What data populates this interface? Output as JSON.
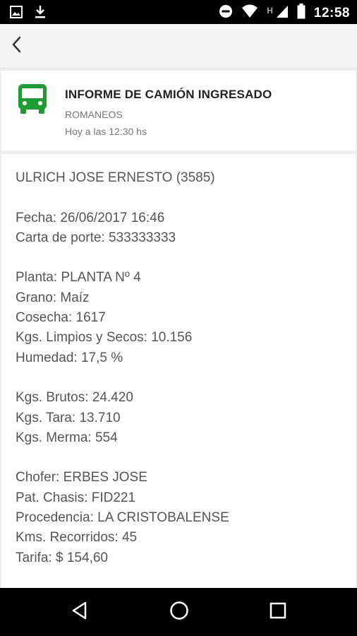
{
  "status_bar": {
    "time": "12:58",
    "network_badge": "H",
    "icons": [
      "image-icon",
      "download-icon",
      "do-not-disturb-icon",
      "wifi-icon",
      "signal-icon",
      "battery-icon"
    ]
  },
  "app_bar": {
    "back_icon": "back-arrow-icon"
  },
  "header": {
    "icon": "bus-icon",
    "icon_color": "#1e9b33",
    "title": "INFORME DE CAMIÓN INGRESADO",
    "subtitle": "ROMANEOS",
    "time": "Hoy a las 12:30 hs"
  },
  "details": {
    "name": "ULRICH JOSE ERNESTO (3585)",
    "fecha": "Fecha: 26/06/2017 16:46",
    "carta_de_porte": "Carta de porte: 533333333",
    "planta": "Planta: PLANTA Nº 4",
    "grano": "Grano: Maíz",
    "cosecha": "Cosecha: 1617",
    "kgs_limpios": "Kgs. Limpios y Secos: 10.156",
    "humedad": "Humedad: 17,5 %",
    "kgs_brutos": "Kgs. Brutos: 24.420",
    "kgs_tara": "Kgs. Tara: 13.710",
    "kgs_merma": "Kgs. Merma: 554",
    "chofer": "Chofer: ERBES JOSE",
    "pat_chasis": "Pat. Chasis: FID221",
    "procedencia": "Procedencia: LA CRISTOBALENSE",
    "kms_recorridos": "Kms. Recorridos: 45",
    "tarifa": "Tarifa: $ 154,60"
  },
  "nav_bar": {
    "icons": [
      "nav-back-icon",
      "nav-home-icon",
      "nav-recents-icon"
    ]
  }
}
